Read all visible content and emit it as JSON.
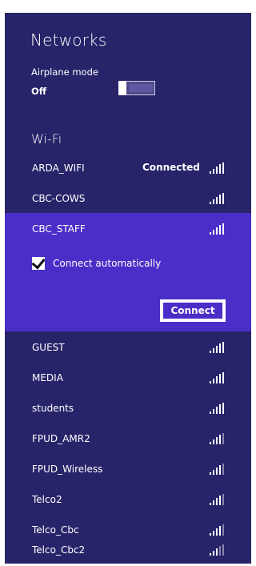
{
  "header": {
    "title": "Networks"
  },
  "airplane_mode": {
    "label": "Airplane mode",
    "value": "Off",
    "enabled": false
  },
  "wifi": {
    "heading": "Wi-Fi",
    "networks": [
      {
        "name": "ARDA_WIFI",
        "status": "Connected",
        "signal": 5
      },
      {
        "name": "CBC-COWS",
        "status": "",
        "signal": 5
      },
      {
        "name": "CBC_STAFF",
        "status": "",
        "signal": 5,
        "selected": true
      },
      {
        "name": "GUEST",
        "status": "",
        "signal": 5
      },
      {
        "name": "MEDIA",
        "status": "",
        "signal": 5
      },
      {
        "name": "students",
        "status": "",
        "signal": 5
      },
      {
        "name": "FPUD_AMR2",
        "status": "",
        "signal": 4
      },
      {
        "name": "FPUD_Wireless",
        "status": "",
        "signal": 4
      },
      {
        "name": "Telco2",
        "status": "",
        "signal": 4
      },
      {
        "name": "Telco_Cbc",
        "status": "",
        "signal": 4
      },
      {
        "name": "Telco_Cbc2",
        "status": "",
        "signal": 3
      }
    ],
    "selected_network": {
      "connect_automatically_label": "Connect automatically",
      "connect_automatically_checked": true,
      "connect_button_label": "Connect"
    }
  },
  "colors": {
    "panel": "#27246a",
    "selected": "#4b2ec8",
    "text": "#ffffff"
  }
}
